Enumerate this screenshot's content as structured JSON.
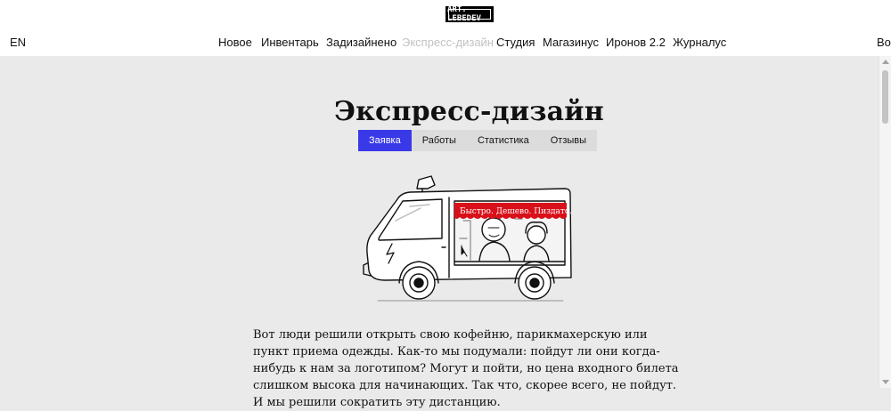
{
  "header": {
    "logo_text": "ART. LEBEDEV",
    "lang": "EN",
    "right_text": "Во",
    "nav": [
      "Новое",
      "Инвентарь",
      "Задизайнено",
      "Экспресс-дизайн",
      "Студия",
      "Магазинус",
      "Иронов 2.2",
      "Журналус"
    ],
    "active_nav": "Экспресс-дизайн"
  },
  "page": {
    "title": "Экспресс-дизайн",
    "tabs": [
      "Заявка",
      "Работы",
      "Статистика",
      "Отзывы"
    ],
    "active_tab": "Заявка"
  },
  "illustration": {
    "banner_text": "Быстро. Дешево. Пиздато."
  },
  "content": {
    "paragraph": "Вот люди решили открыть свою кофейню, парикмахерскую или пункт приема одежды. Как-то мы подумали: пойдут ли они когда-нибудь к нам за логотипом? Могут и пойти, но цена входного билета слишком высока для начинающих. Так что, скорее всего, не пойдут. И мы решили сократить эту дистанцию."
  },
  "colors": {
    "accent": "#3a39e8",
    "banner_red": "#d9101a",
    "background": "#ebeaeb"
  }
}
